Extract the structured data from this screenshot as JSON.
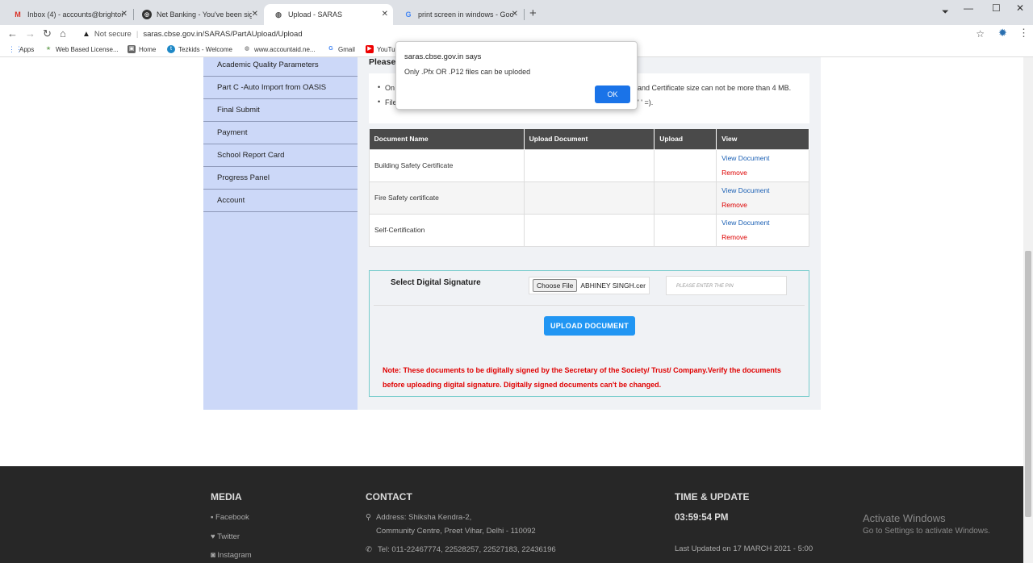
{
  "browser": {
    "tabs": [
      {
        "title": "Inbox (4) - accounts@brightonin",
        "icon": "gmail-icon"
      },
      {
        "title": "Net Banking - You've been signe",
        "icon": "bank-icon"
      },
      {
        "title": "Upload - SARAS",
        "icon": "globe-icon"
      },
      {
        "title": "print screen in windows - Google",
        "icon": "google-icon"
      }
    ],
    "security": "Not secure",
    "url": "saras.cbse.gov.in/SARAS/PartAUpload/Upload",
    "bookmarks": [
      "Apps",
      "Web Based License...",
      "Home",
      "Tezkids - Welcome",
      "www.accountaid.ne...",
      "Gmail",
      "YouTu"
    ]
  },
  "sidebar": {
    "items": [
      {
        "label": "Academic Quality Parameters"
      },
      {
        "label": "Part C -Auto Import from OASIS"
      },
      {
        "label": "Final Submit"
      },
      {
        "label": "Payment"
      },
      {
        "label": "School Report Card"
      },
      {
        "label": "Progress Panel"
      },
      {
        "label": "Account"
      }
    ]
  },
  "main": {
    "heading": "Please",
    "note1_start": "On",
    "note1_end": "and Certificate size can not be more than 4 MB.",
    "note2_start": "File",
    "note2_end": "' ' =).",
    "table": {
      "headers": [
        "Document Name",
        "Upload Document",
        "Upload",
        "View"
      ],
      "rows": [
        {
          "name": "Building Safety Certificate",
          "view": "View Document",
          "remove": "Remove"
        },
        {
          "name": "Fire Safety certificate",
          "view": "View Document",
          "remove": "Remove"
        },
        {
          "name": "Self-Certification",
          "view": "View Document",
          "remove": "Remove"
        }
      ]
    },
    "signature": {
      "label": "Select Digital Signature",
      "choose_file": "Choose File",
      "file_name": "ABHINEY SINGH.cer",
      "pin_placeholder": "PLEASE ENTER THE PIN",
      "upload_button": "UPLOAD DOCUMENT",
      "note": "Note: These documents to be digitally signed by the Secretary of the Society/ Trust/ Company.Verify the documents before uploading digital signature. Digitally signed documents can't be changed."
    }
  },
  "footer": {
    "media": {
      "heading": "MEDIA",
      "links": [
        "Facebook",
        "Twitter",
        "Instagram"
      ]
    },
    "contact": {
      "heading": "CONTACT",
      "address_line1": "Address: Shiksha Kendra-2,",
      "address_line2": "Community Centre, Preet Vihar, Delhi - 110092",
      "tel": "Tel: 011-22467774, 22528257, 22527183, 22436196"
    },
    "time": {
      "heading": "TIME & UPDATE",
      "clock": "03:59:54 PM",
      "last_updated": "Last Updated on 17 MARCH 2021 - 5:00"
    },
    "watermark": {
      "title": "Activate Windows",
      "subtitle": "Go to Settings to activate Windows."
    }
  },
  "dialog": {
    "title": "saras.cbse.gov.in says",
    "message": "Only .Pfx OR .P12 files can be uploded",
    "ok": "OK"
  },
  "colors": {
    "sidebar": "#ccd8f8",
    "accent": "#2196f3",
    "note_red": "#e00000",
    "footer": "#272727"
  }
}
